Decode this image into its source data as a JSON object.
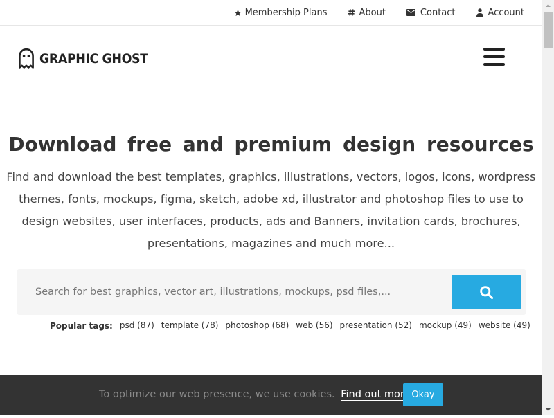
{
  "topnav": {
    "items": [
      {
        "label": "Membership Plans",
        "icon": "star-icon"
      },
      {
        "label": "About",
        "icon": "hash-icon"
      },
      {
        "label": "Contact",
        "icon": "envelope-icon"
      },
      {
        "label": "Account",
        "icon": "user-icon"
      }
    ]
  },
  "header": {
    "logo_text": "GRAPHIC GHOST",
    "menu_icon": "hamburger-icon"
  },
  "hero": {
    "title": "Download free and premium design resources",
    "description": "Find and download the best templates, graphics, illustrations, vectors, logos, icons, wordpress themes, fonts, mockups, figma, sketch, adobe xd, illustrator and photoshop files to use to design websites, user interfaces, products, ads and Banners, invitation cards, brochures, presentations, magazines and much more..."
  },
  "search": {
    "placeholder": "Search for best graphics, vector art, illustrations, mockups, psd files,...",
    "button_icon": "search-icon"
  },
  "tags": {
    "label": "Popular tags:",
    "items": [
      "psd (87)",
      "template (78)",
      "photoshop (68)",
      "web (56)",
      "presentation (52)",
      "mockup (49)",
      "website (49)"
    ]
  },
  "cookie": {
    "text": "To optimize our web presence, we use cookies.",
    "link": "Find out more.",
    "button": "Okay"
  },
  "colors": {
    "accent": "#27aae1",
    "cookie_bg": "#333333",
    "text": "#333333"
  }
}
